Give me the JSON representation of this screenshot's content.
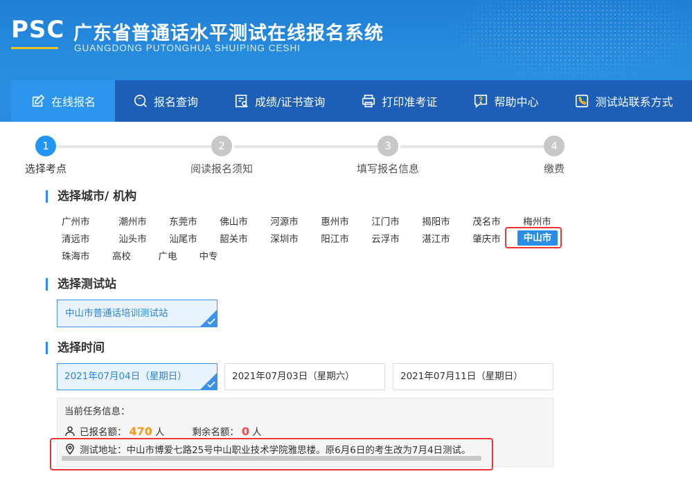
{
  "header": {
    "logo_text": "PSC",
    "title": "广东省普通话水平测试在线报名系统",
    "subtitle": "GUANGDONG PUTONGHUA SHUIPING CESHI"
  },
  "nav": [
    {
      "label": "在线报名",
      "icon": "edit-icon",
      "active": true
    },
    {
      "label": "报名查询",
      "icon": "search-icon"
    },
    {
      "label": "成绩/证书查询",
      "icon": "certificate-search-icon"
    },
    {
      "label": "打印准考证",
      "icon": "printer-icon"
    },
    {
      "label": "帮助中心",
      "icon": "help-icon"
    },
    {
      "label": "测试站联系方式",
      "icon": "phone-icon"
    }
  ],
  "steps": [
    {
      "num": "1",
      "label": "选择考点"
    },
    {
      "num": "2",
      "label": "阅读报名须知"
    },
    {
      "num": "3",
      "label": "填写报名信息"
    },
    {
      "num": "4",
      "label": "缴费"
    }
  ],
  "sections": {
    "city": "选择城市/ 机构",
    "station": "选择测试站",
    "time": "选择时间"
  },
  "cities": [
    [
      "广州市",
      "潮州市",
      "东莞市",
      "佛山市",
      "河源市",
      "惠州市",
      "江门市",
      "揭阳市",
      "茂名市",
      "梅州市"
    ],
    [
      "清远市",
      "汕头市",
      "汕尾市",
      "韶关市",
      "深圳市",
      "阳江市",
      "云浮市",
      "湛江市",
      "肇庆市",
      "中山市"
    ],
    [
      "珠海市",
      "高校",
      "广电",
      "中专"
    ]
  ],
  "selected_city": "中山市",
  "station": "中山市普通话培训测试站",
  "dates": [
    "2021年07月04日（星期日）",
    "2021年07月03日（星期六）",
    "2021年07月11日（星期日）"
  ],
  "info": {
    "heading": "当前任务信息：",
    "registered_label": "已报名额：",
    "registered_value": "470",
    "remaining_label": "剩余名额：",
    "remaining_value": "0",
    "unit": "人",
    "address": "测试地址：中山市博爱七路25号中山职业技术学院雅思楼。原6月6日的考生改为7月4日测试。"
  },
  "colors": {
    "accent": "#2b8ee6",
    "nav_bg": "#1d5fb6",
    "highlight": "#e33333",
    "orange": "#f39a1e",
    "red": "#ef4b4b"
  }
}
